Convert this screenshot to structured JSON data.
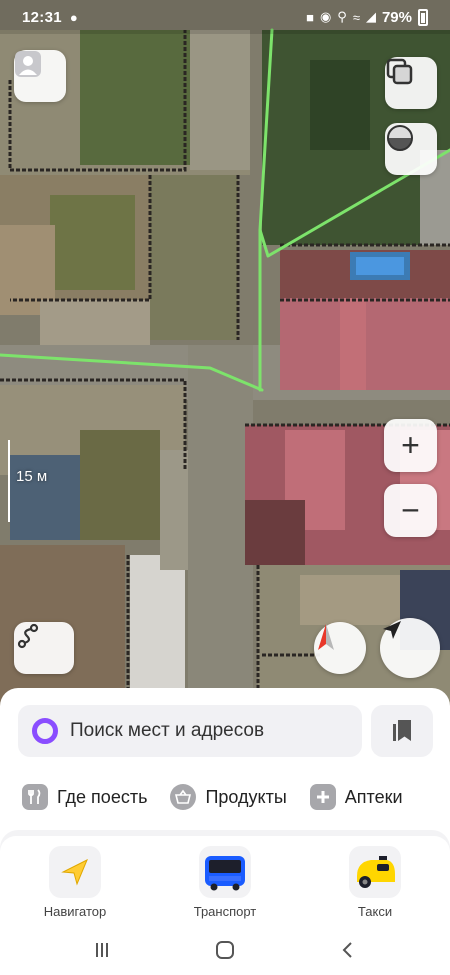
{
  "status_bar": {
    "time": "12:31",
    "battery": "79%",
    "icons": [
      "message-icon",
      "notification-icon",
      "record-icon",
      "location-icon",
      "wifi-icon",
      "volte-icon",
      "signal-icon",
      "battery-icon"
    ]
  },
  "map": {
    "scale_label": "15 m",
    "scale_label_text": "15 м",
    "buttons": {
      "profile": "avatar-icon",
      "layers": "layers-icon",
      "mode": "half-circle-icon",
      "zoom_in": "+",
      "zoom_out": "−",
      "route": "route-icon",
      "compass": "compass-icon",
      "locate": "navigation-arrow-icon"
    }
  },
  "search": {
    "placeholder": "Поиск мест и адресов"
  },
  "categories": [
    {
      "label": "Где поесть",
      "icon": "fork-knife-icon"
    },
    {
      "label": "Продукты",
      "icon": "basket-icon"
    },
    {
      "label": "Аптеки",
      "icon": "plus-icon"
    }
  ],
  "apps": [
    {
      "label": "Навигатор",
      "icon": "navigator-arrow-icon"
    },
    {
      "label": "Транспорт",
      "icon": "bus-icon"
    },
    {
      "label": "Такси",
      "icon": "taxi-icon"
    }
  ],
  "colors": {
    "accent_alice": "#8a4dff",
    "route_green": "#7de36b",
    "taxi_yellow": "#ffd600",
    "bus_blue": "#1a5cff",
    "navigator_yellow": "#ffcc33"
  }
}
